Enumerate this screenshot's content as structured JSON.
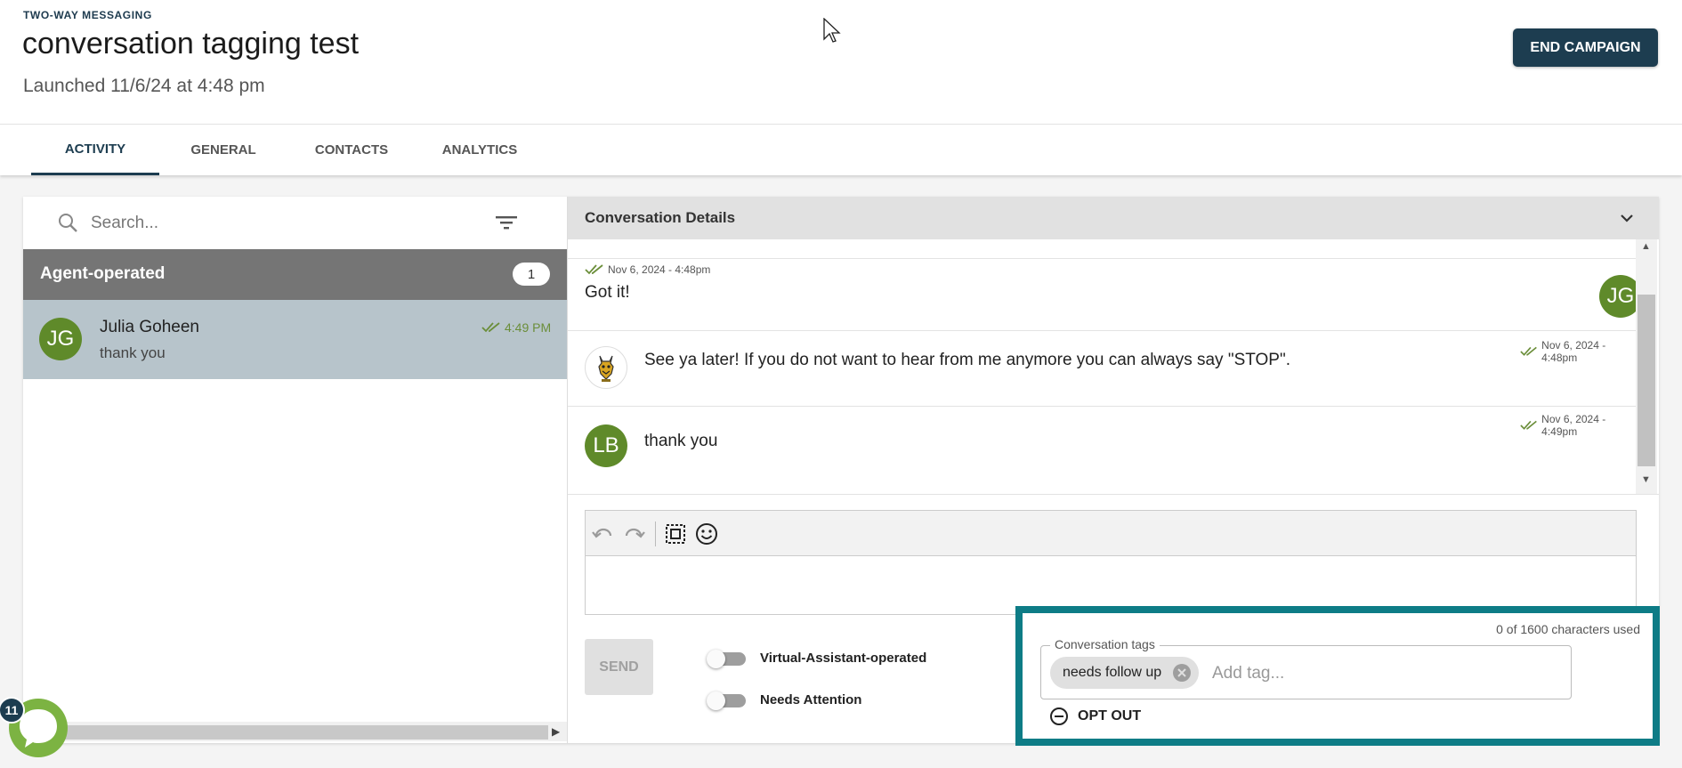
{
  "header": {
    "eyebrow": "TWO-WAY MESSAGING",
    "title": "conversation tagging test",
    "launched": "Launched 11/6/24 at 4:48 pm",
    "end_campaign_label": "END CAMPAIGN"
  },
  "tabs": [
    {
      "label": "ACTIVITY",
      "active": true
    },
    {
      "label": "GENERAL",
      "active": false
    },
    {
      "label": "CONTACTS",
      "active": false
    },
    {
      "label": "ANALYTICS",
      "active": false
    }
  ],
  "sidebar": {
    "search_placeholder": "Search...",
    "group": {
      "title": "Agent-operated",
      "count": "1"
    },
    "conversation": {
      "initials": "JG",
      "name": "Julia Goheen",
      "preview": "thank you",
      "time": "4:49 PM"
    }
  },
  "details": {
    "title": "Conversation Details",
    "messages": [
      {
        "timestamp": "Nov 6, 2024 - 4:48pm",
        "text": "Got it!",
        "initials": "JG",
        "side": "right"
      },
      {
        "timestamp": "Nov 6, 2024 - 4:48pm",
        "text": "See ya later! If you do not want to hear from me anymore you can always say \"STOP\".",
        "avatar": "bot-mascot-icon",
        "side": "left"
      },
      {
        "timestamp": "Nov 6, 2024 - 4:49pm",
        "text": "thank you",
        "initials": "LB",
        "side": "left"
      }
    ]
  },
  "composer": {
    "send_label": "SEND",
    "toggles": [
      {
        "label": "Virtual-Assistant-operated",
        "on": false
      },
      {
        "label": "Needs Attention",
        "on": false
      }
    ],
    "char_count": "0 of 1600 characters used"
  },
  "tags": {
    "legend": "Conversation tags",
    "chips": [
      "needs follow up"
    ],
    "input_placeholder": "Add tag...",
    "opt_out_label": "OPT OUT"
  },
  "chat_widget": {
    "badge": "11"
  },
  "colors": {
    "primary": "#1d3d50",
    "avatar_green": "#5f8a2a",
    "read_check": "#6b8e3a",
    "highlight_border": "#0e7c86",
    "selected_row": "#b7c4cb",
    "group_header": "#757575"
  }
}
